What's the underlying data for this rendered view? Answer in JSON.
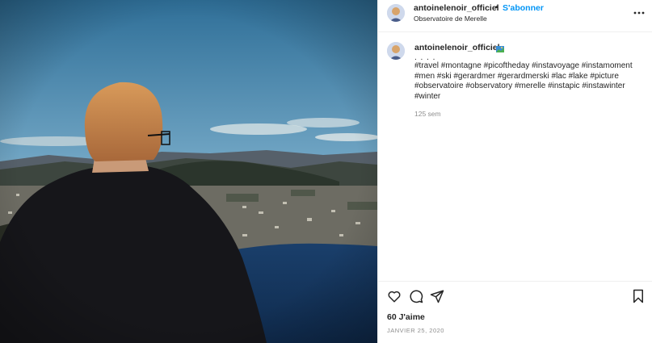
{
  "post": {
    "photo_icon": "photo-person-overlooking-lake",
    "username": "antoinelenoir_officiel",
    "separator": "•",
    "follow_label": "S'abonner",
    "location": "Observatoire de Merelle",
    "more_icon": "more-horizontal-icon"
  },
  "caption": {
    "username": "antoinelenoir_officiel",
    "emoji_icon": "flag-emoji-icon",
    "dots": ". . . .",
    "hashtags": "#travel #montagne #picoftheday #instavoyage #instamoment #men #ski #gerardmer #gerardmerski #lac #lake #picture #observatoire #observatory #merelle #instapic #instawinter #winter",
    "time_ago": "125 sem"
  },
  "actions": {
    "like_icon": "heart-icon",
    "comment_icon": "comment-icon",
    "share_icon": "paper-plane-icon",
    "save_icon": "bookmark-icon"
  },
  "stats": {
    "likes": "60 J'aime",
    "date": "JANVIER 25, 2020"
  },
  "colors": {
    "link": "#0095f6",
    "text": "#262626",
    "muted": "#8e8e8e",
    "border": "#efefef"
  }
}
